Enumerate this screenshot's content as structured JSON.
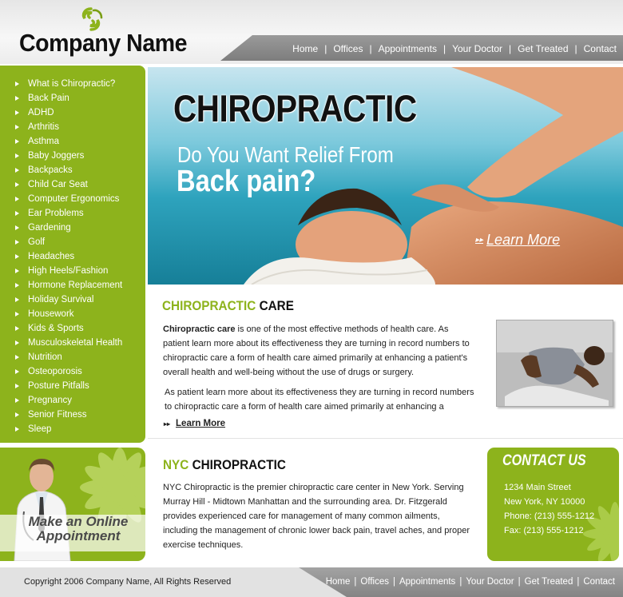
{
  "brand": {
    "company_name": "Company Name",
    "logo_icon": "swirl-logo-icon",
    "accent_color": "#8db31c"
  },
  "topnav": [
    "Home",
    "Offices",
    "Appointments",
    "Your Doctor",
    "Get Treated",
    "Contact"
  ],
  "sidebar": {
    "items": [
      "What is Chiropractic?",
      "Back Pain",
      "ADHD",
      "Arthritis",
      "Asthma",
      "Baby Joggers",
      "Backpacks",
      "Child Car Seat",
      "Computer Ergonomics",
      "Ear Problems",
      "Gardening",
      "Golf",
      "Headaches",
      "High Heels/Fashion",
      "Hormone Replacement",
      "Holiday Survival",
      "Housework",
      "Kids & Sports",
      "Musculoskeletal Health",
      "Nutrition",
      "Osteoporosis",
      "Posture Pitfalls",
      "Pregnancy",
      "Senior Fitness",
      "Sleep"
    ]
  },
  "appointment": {
    "line1": "Make an Online",
    "line2": "Appointment"
  },
  "hero": {
    "headline": "CHIROPRACTIC",
    "subline": "Do You Want Relief From",
    "emphasis": "Back pain?",
    "learn_more": "Learn More"
  },
  "care": {
    "title_green": "CHIROPRACTIC",
    "title_dark": "CARE",
    "lead_bold": "Chiropractic care",
    "paragraph1_rest": " is one of the most effective methods of health care. As patient learn more about its effectiveness they are turning in record numbers to chiropractic care a form of health care aimed primarily at enhancing a patient's overall health and well-being without the use of drugs or surgery.",
    "paragraph2": "As patient learn more about its effectiveness they are turning in record numbers to chiropractic care a form of health care aimed primarily at enhancing a",
    "learn_more": "Learn More"
  },
  "nyc": {
    "title_green": "NYC",
    "title_dark": "CHIROPRACTIC",
    "paragraph": "NYC Chiropractic is the premier chiropractic care center in New York. Serving Murray Hill - Midtown Manhattan and the surrounding area. Dr. Fitzgerald provides experienced care for management of many common ailments, including the management of chronic lower back pain, travel aches, and proper exercise techniques."
  },
  "contact": {
    "title": "CONTACT US",
    "address1": "1234 Main Street",
    "address2": "New York, NY 10000",
    "phone": "Phone:  (213) 555-1212",
    "fax": "Fax:  (213) 555-1212"
  },
  "footer": {
    "copyright": "Copyright 2006 Company Name, All Rights Reserved",
    "nav": [
      "Home",
      "Offices",
      "Appointments",
      "Your Doctor",
      "Get Treated",
      "Contact"
    ]
  }
}
